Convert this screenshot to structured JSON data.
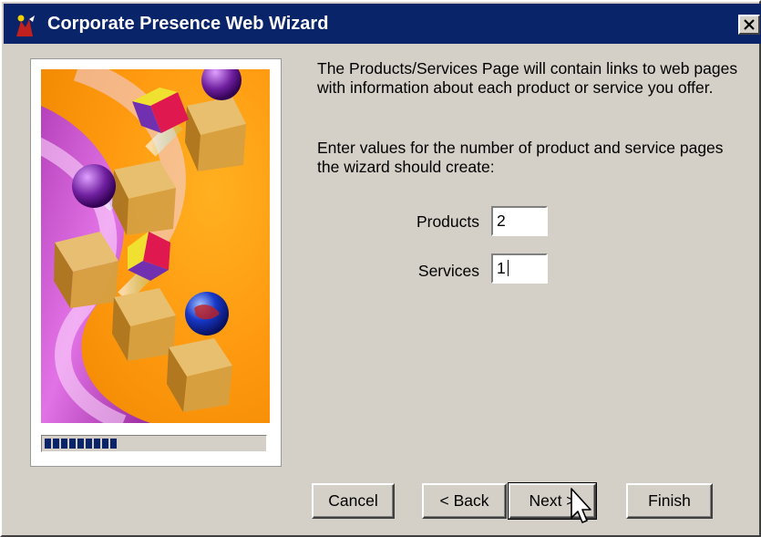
{
  "window": {
    "title": "Corporate Presence Web Wizard"
  },
  "content": {
    "description": "The Products/Services Page will contain links to web pages with information about each product or service you offer.",
    "instruction": "Enter values for the number of product and service pages the wizard should create:"
  },
  "fields": {
    "products": {
      "label": "Products",
      "value": "2"
    },
    "services": {
      "label": "Services",
      "value": "1"
    }
  },
  "buttons": {
    "cancel": "Cancel",
    "back": "< Back",
    "next": "Next >",
    "finish": "Finish"
  },
  "progress": {
    "segments_filled": 9
  },
  "icons": {
    "app": "wizard-app-icon",
    "close": "close-icon",
    "cursor": "mouse-pointer-icon"
  },
  "colors": {
    "titlebar": "#0a246a",
    "face": "#d4d0c8",
    "progress": "#0a246a"
  }
}
